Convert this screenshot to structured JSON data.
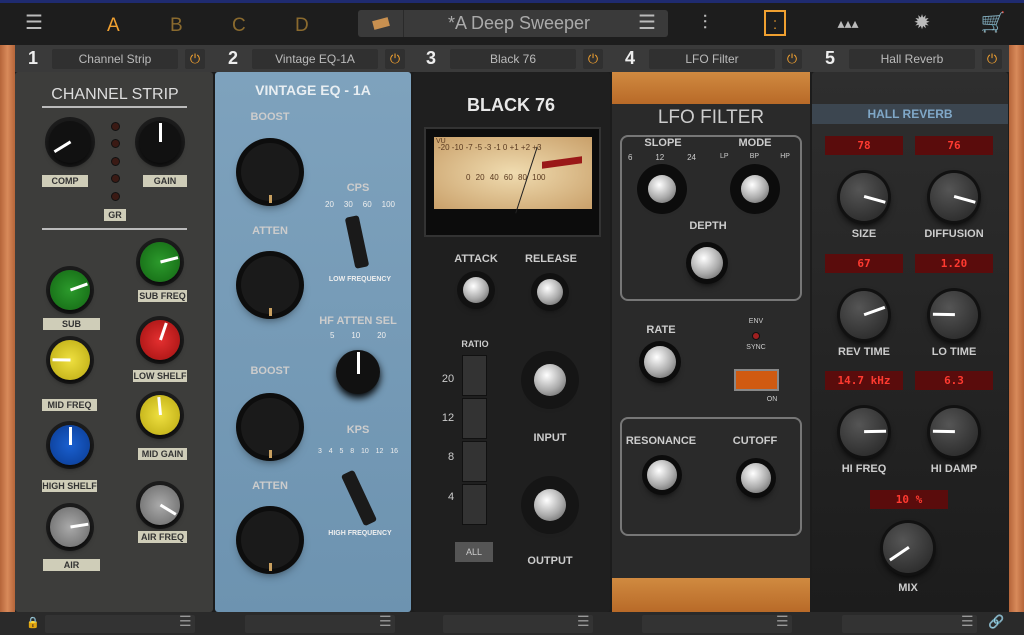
{
  "topbar": {
    "menu_icon": "hamburger-icon",
    "slots": [
      "A",
      "B",
      "C",
      "D"
    ],
    "active_slot": "A",
    "preset_name": "*A Deep Sweeper",
    "preset_icon": "preset-folder-icon",
    "preset_menu_icon": "list-icon",
    "tools": [
      "mixer-icon",
      "pedal-icon",
      "network-icon",
      "gear-icon",
      "cart-icon"
    ],
    "active_tool": "pedal-icon",
    "accent": "#f0a030"
  },
  "modules": [
    {
      "num": "1",
      "name": "Channel Strip"
    },
    {
      "num": "2",
      "name": "Vintage EQ-1A"
    },
    {
      "num": "3",
      "name": "Black 76"
    },
    {
      "num": "4",
      "name": "LFO Filter"
    },
    {
      "num": "5",
      "name": "Hall Reverb"
    }
  ],
  "channel_strip": {
    "title": "CHANNEL STRIP",
    "labels": {
      "comp": "COMP",
      "gain": "GAIN",
      "gr": "GR",
      "sub": "SUB",
      "sub_freq": "SUB FREQ",
      "low_shelf": "LOW SHELF",
      "mid_freq": "MID FREQ",
      "mid_gain": "MID GAIN",
      "high_shelf": "HIGH SHELF",
      "air": "AIR",
      "air_freq": "AIR FREQ"
    },
    "knobs": {
      "comp": 0.05,
      "gain": 0.5,
      "sub": 0.76,
      "sub_freq": 0.78,
      "low_shelf": 0.57,
      "mid_freq": 0.17,
      "mid_gain": 0.48,
      "high_shelf": 0.5,
      "air": 0.8,
      "air_freq": 0.95
    }
  },
  "vintage_eq": {
    "title": "VINTAGE EQ - 1A",
    "boost": "BOOST",
    "atten": "ATTEN",
    "cps": "CPS",
    "cps_ticks": [
      "20",
      "30",
      "60",
      "100"
    ],
    "low_frequency": "LOW FREQUENCY",
    "hf_atten_sel": "HF ATTEN SEL",
    "hf_ticks": [
      "5",
      "10",
      "20"
    ],
    "kps": "KPS",
    "kps_ticks": [
      "3",
      "4",
      "5",
      "8",
      "10",
      "12",
      "16"
    ],
    "high_frequency": "HIGH FREQUENCY"
  },
  "black76": {
    "title": "BLACK 76",
    "vu_top": "-20 -10 -7 -5 -3 -1 0 +1 +2 +3",
    "vu_bottom": "0 20 40 60 80 100",
    "vu_label": "VU",
    "attack": "ATTACK",
    "release": "RELEASE",
    "ratio": "RATIO",
    "ratios": [
      "20",
      "12",
      "8",
      "4"
    ],
    "all": "ALL",
    "input": "INPUT",
    "output": "OUTPUT"
  },
  "lfo_filter": {
    "title": "LFO FILTER",
    "slope": "SLOPE",
    "slope_ticks": [
      "6",
      "12",
      "24"
    ],
    "mode": "MODE",
    "mode_ticks": [
      "LP",
      "BP",
      "HP"
    ],
    "depth": "DEPTH",
    "rate": "RATE",
    "env": "ENV",
    "sync": "SYNC",
    "on": "ON",
    "resonance": "RESONANCE",
    "cutoff": "CUTOFF"
  },
  "reverb": {
    "title": "HALL REVERB",
    "params": [
      {
        "label": "SIZE",
        "value": "78",
        "level": 0.89
      },
      {
        "label": "DIFFUSION",
        "value": "76",
        "level": 0.89
      },
      {
        "label": "REV TIME",
        "value": "67",
        "level": 0.76
      },
      {
        "label": "LO TIME",
        "value": "1.20",
        "level": 0.17
      },
      {
        "label": "HI FREQ",
        "value": "14.7 kHz",
        "level": 0.83
      },
      {
        "label": "HI DAMP",
        "value": "6.3",
        "level": 0.17
      }
    ],
    "mix": {
      "label": "MIX",
      "value": "10 %",
      "level": 0.04
    }
  },
  "bottombar": {
    "lock_icon": "lock-icon",
    "link_icon": "link-icon"
  }
}
